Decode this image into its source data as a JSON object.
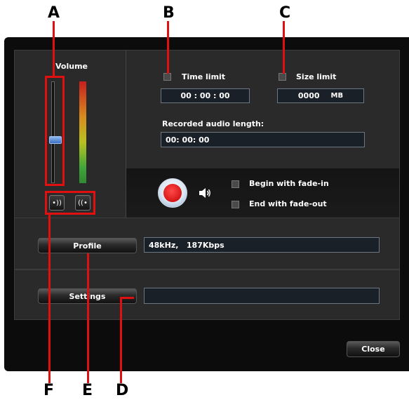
{
  "callouts": {
    "top": [
      "A",
      "B",
      "C"
    ],
    "bottom": [
      "F",
      "E",
      "D"
    ]
  },
  "volume": {
    "label": "Volume",
    "level": 0.42
  },
  "time_limit": {
    "label": "Time limit",
    "value": "00 : 00 : 00"
  },
  "size_limit": {
    "label": "Size limit",
    "value": "0000",
    "unit": "MB"
  },
  "recorded": {
    "label": "Recorded audio length:",
    "value": "00: 00: 00"
  },
  "fade": {
    "begin_label": "Begin with fade-in",
    "end_label": "End with fade-out"
  },
  "profile": {
    "button_label": "Profile",
    "value": "48kHz,   187Kbps"
  },
  "settings": {
    "button_label": "Settings",
    "value": ""
  },
  "close_label": "Close",
  "colors": {
    "callout": "#e01010",
    "record": "#d40000",
    "thumb": "#3a6fc0"
  },
  "icons": [
    "speaker-icon",
    "mic-indicator-icon",
    "signal-wave-icon",
    "record-icon"
  ]
}
